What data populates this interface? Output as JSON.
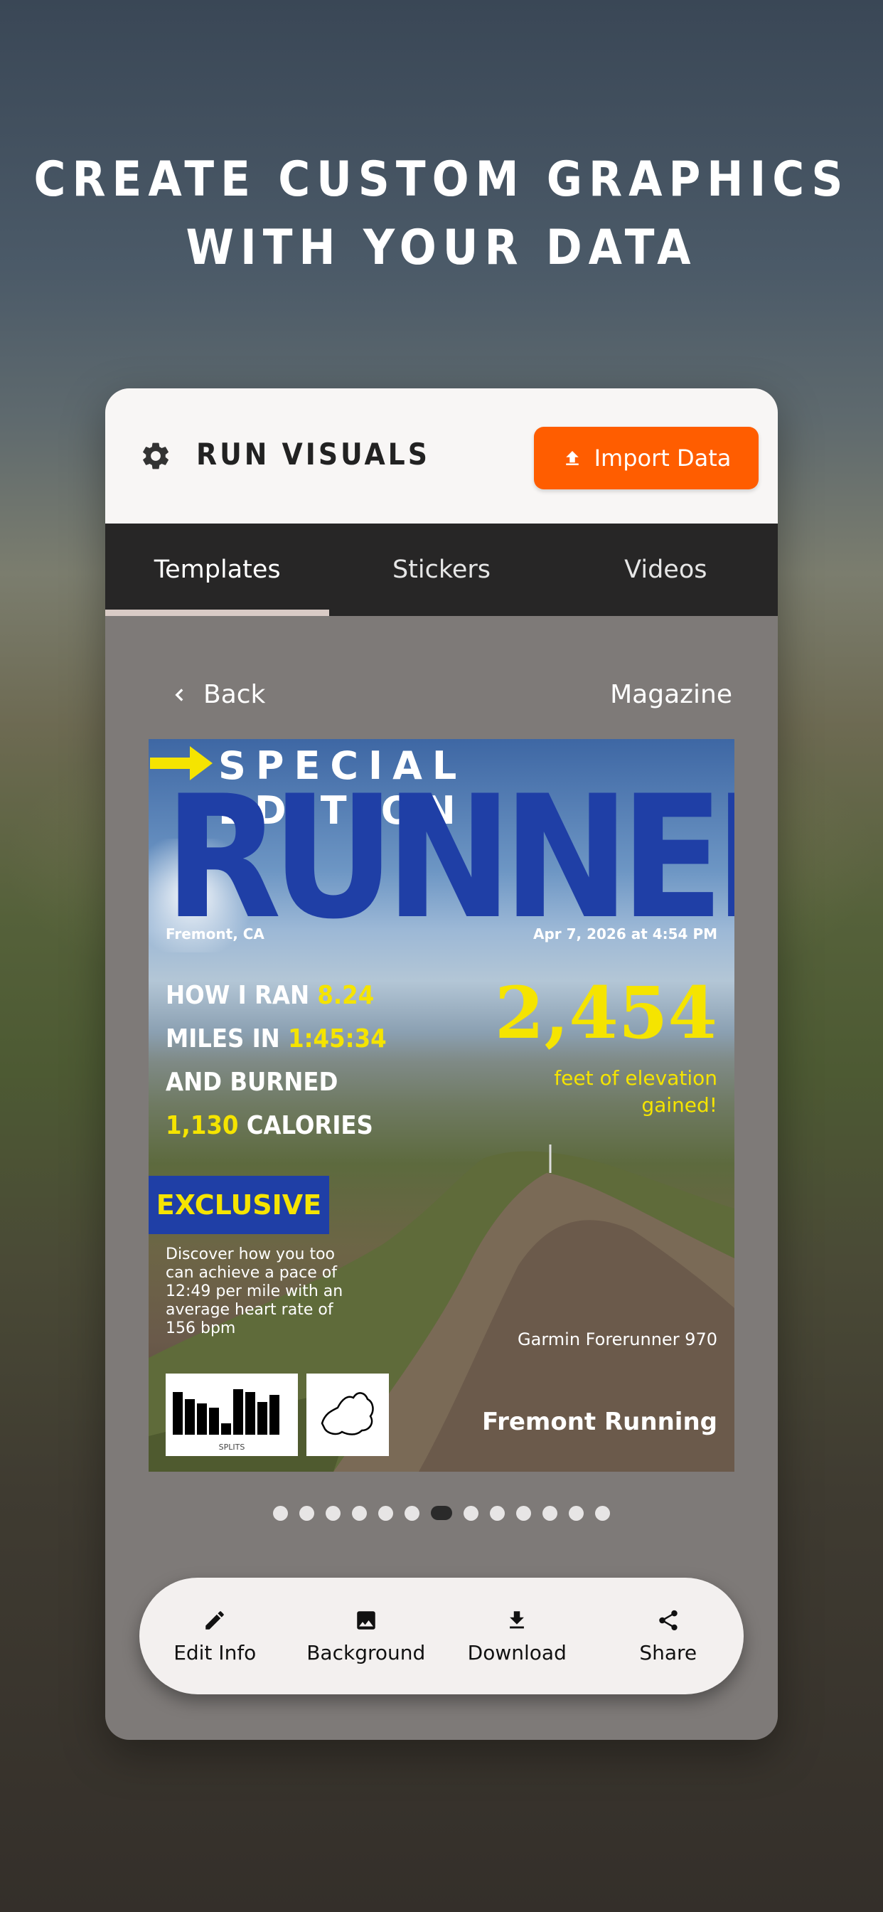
{
  "hero": {
    "line1": "CREATE CUSTOM GRAPHICS",
    "line2": "WITH YOUR DATA"
  },
  "app": {
    "brand": "RUN VISUALS",
    "import_label": "Import Data",
    "accent": "#ff5d00",
    "icons": [
      "gear-icon",
      "upload-icon"
    ]
  },
  "tabs": [
    {
      "label": "Templates",
      "active": true
    },
    {
      "label": "Stickers",
      "active": false
    },
    {
      "label": "Videos",
      "active": false
    }
  ],
  "nav": {
    "back_label": "Back",
    "template_name": "Magazine"
  },
  "cover": {
    "special": "SPECIAL EDITION",
    "title": "RUNNER",
    "location": "Fremont, CA",
    "date": "Apr 7, 2026 at 4:54 PM",
    "headline": {
      "l1_prefix": "HOW I RAN ",
      "distance": "8.24",
      "l2_prefix": "MILES IN ",
      "time": "1:45:34",
      "l3": "AND BURNED",
      "calories": "1,130",
      "l4_suffix": " CALORIES"
    },
    "elevation": "2,454",
    "elevation_text_1": "feet of elevation",
    "elevation_text_2": "gained!",
    "exclusive": "EXCLUSIVE",
    "exclusive_body": "Discover how you too can achieve a pace of 12:49 per mile with an average heart rate of 156 bpm",
    "device": "Garmin Forerunner 970",
    "club": "Fremont Running",
    "splits_label": "SPLITS",
    "highlight_color": "#f5e400",
    "title_color": "#1f3fa6"
  },
  "pagination": {
    "total": 13,
    "active_index": 6
  },
  "actions": [
    {
      "label": "Edit Info",
      "icon": "pencil-icon"
    },
    {
      "label": "Background",
      "icon": "image-icon"
    },
    {
      "label": "Download",
      "icon": "download-icon"
    },
    {
      "label": "Share",
      "icon": "share-icon"
    }
  ]
}
